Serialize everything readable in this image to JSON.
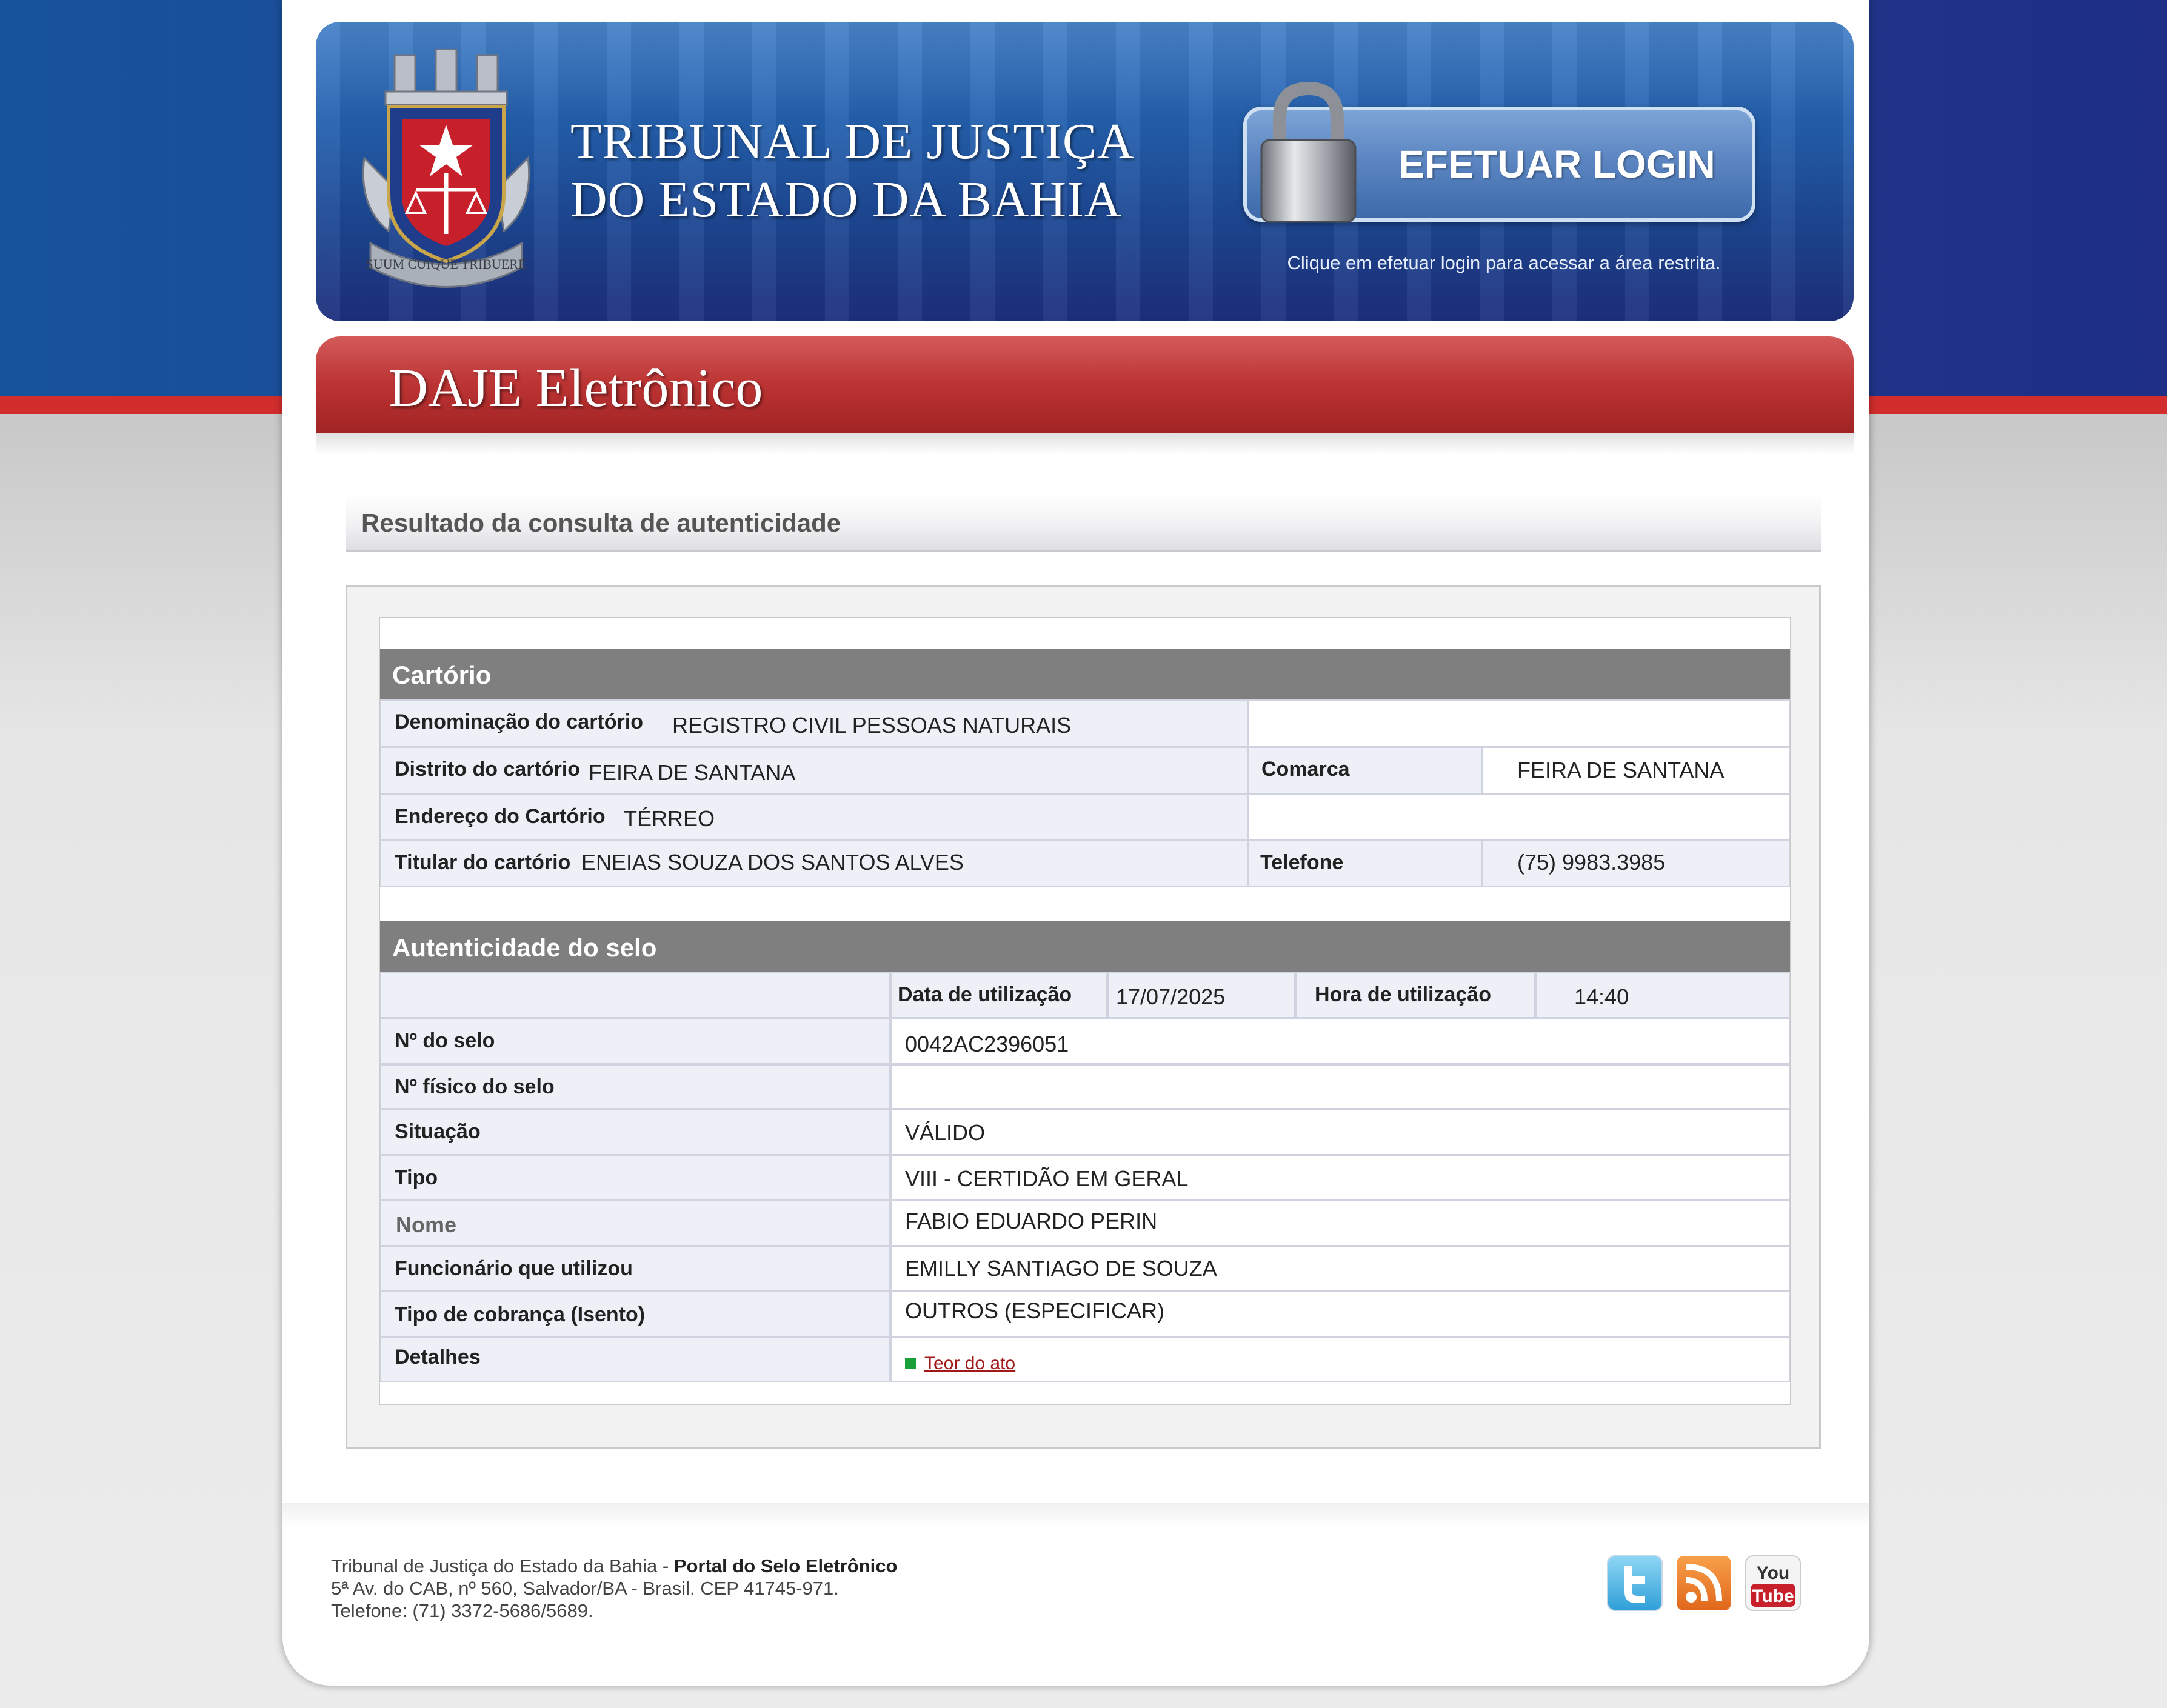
{
  "header": {
    "title_line1": "TRIBUNAL DE JUSTIÇA",
    "title_line2": "DO ESTADO DA BAHIA",
    "crest_motto": "SUUM CUIQUE TRIBUERE",
    "login_label": "EFETUAR LOGIN",
    "login_hint": "Clique em efetuar login para acessar a área restrita."
  },
  "section_title": "DAJE Eletrônico",
  "result_title": "Resultado da consulta de autenticidade",
  "cartorio": {
    "heading": "Cartório",
    "denominacao_label": "Denominação do cartório",
    "denominacao_value": "REGISTRO CIVIL PESSOAS NATURAIS",
    "distrito_label": "Distrito do cartório",
    "distrito_value": "FEIRA DE SANTANA",
    "comarca_label": "Comarca",
    "comarca_value": "FEIRA DE SANTANA",
    "endereco_label": "Endereço do Cartório",
    "endereco_value": "TÉRREO",
    "titular_label": "Titular do cartório",
    "titular_value": "ENEIAS SOUZA DOS SANTOS ALVES",
    "telefone_label": "Telefone",
    "telefone_value": "(75) 9983.3985"
  },
  "selo": {
    "heading": "Autenticidade do selo",
    "data_label": "Data de utilização",
    "data_value": "17/07/2025",
    "hora_label": "Hora de utilização",
    "hora_value": "14:40",
    "numero_label": "Nº do selo",
    "numero_value": "0042AC2396051",
    "fisico_label": "Nº físico do selo",
    "fisico_value": "",
    "situacao_label": "Situação",
    "situacao_value": "VÁLIDO",
    "tipo_label": "Tipo",
    "tipo_value": "VIII - CERTIDÃO EM GERAL",
    "nome_label": "Nome",
    "nome_value": "FABIO EDUARDO PERIN",
    "funcionario_label": "Funcionário que utilizou",
    "funcionario_value": "EMILLY SANTIAGO DE SOUZA",
    "cobranca_label": "Tipo de cobrança (Isento)",
    "cobranca_value": "OUTROS (ESPECIFICAR)",
    "detalhes_label": "Detalhes",
    "detalhes_link": "Teor do ato"
  },
  "footer": {
    "org": "Tribunal de Justiça do Estado da Bahia - ",
    "portal": "Portal do Selo Eletrônico",
    "address": "5ª Av. do CAB, nº 560, Salvador/BA - Brasil. CEP 41745-971.",
    "phone": "Telefone: (71) 3372-5686/5689.",
    "youtube_top": "You",
    "youtube_bottom": "Tube"
  },
  "icons": {
    "twitter": "twitter-icon",
    "rss": "rss-icon",
    "youtube": "youtube-icon",
    "lock": "padlock-icon",
    "crest": "coat-of-arms-icon"
  },
  "colors": {
    "header_blue": "#2460ae",
    "daje_red": "#bc3333",
    "section_grey": "#7f7f7f",
    "label_bg": "#eef0f8",
    "link_red": "#a01818",
    "bullet_green": "#1aa038"
  }
}
